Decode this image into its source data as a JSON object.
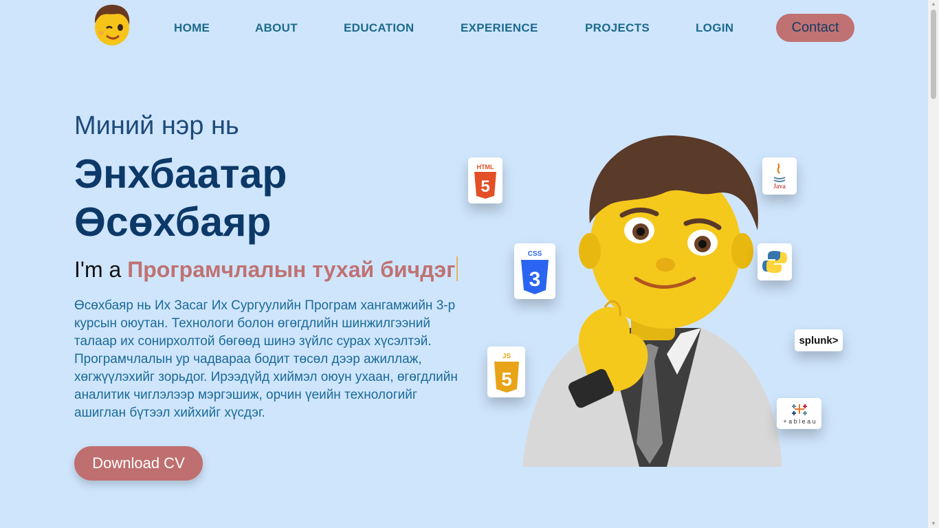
{
  "nav": {
    "links": [
      "HOME",
      "ABOUT",
      "EDUCATION",
      "EXPERIENCE",
      "PROJECTS",
      "LOGIN"
    ],
    "contact_label": "Contact",
    "logo_icon": "winking-face-avatar-icon"
  },
  "hero": {
    "intro": "Миний нэр нь",
    "name_line1": "Энхбаатар",
    "name_line2": "Өсөхбаяр",
    "role_prefix": "I'm a",
    "role_typed": "Програмчлалын тухай бичдэг",
    "bio": "Өсөхбаяр нь Их Засаг Их Сургуулийн Програм хангамжийн 3-р курсын оюутан. Технологи болон өгөгдлийн шинжилгээний талаар их сонирхолтой бөгөөд шинэ зүйлс сурах хүсэлтэй. Програмчлалын ур чадвараа бодит төсөл дээр ажиллаж, хөгжүүлэхийг зорьдог. Ирээдүйд хиймэл оюун ухаан, өгөгдлийн аналитик чиглэлээр мэргэшиж, орчин үеийн технологийг ашиглан бүтээл хийхийг хүсдэг.",
    "download_label": "Download CV"
  },
  "badges": {
    "html_text": "HTML",
    "css_text": "CSS",
    "js_text": "JS",
    "java_text": "Java",
    "splunk_text": "splunk>",
    "tableau_text": "+ a b l e a u"
  },
  "colors": {
    "background": "#cfe5fc",
    "accent": "#bf6f6f",
    "nav_link": "#1c6a8c",
    "heading": "#0c3968"
  }
}
